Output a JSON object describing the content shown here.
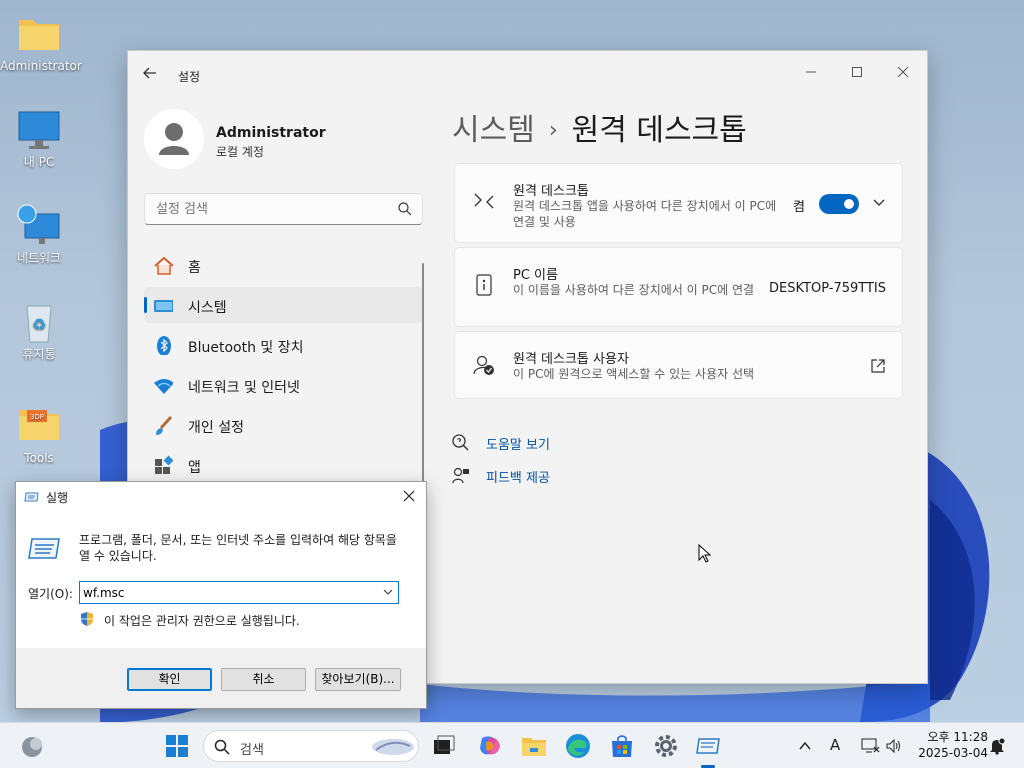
{
  "desktop": {
    "icons": [
      {
        "label": "Administrator"
      },
      {
        "label": "내 PC"
      },
      {
        "label": "네트워크"
      },
      {
        "label": "휴지통"
      },
      {
        "label": "Tools"
      }
    ]
  },
  "settings": {
    "title": "설정",
    "profile": {
      "name": "Administrator",
      "account": "로컬 계정"
    },
    "search_placeholder": "설정 검색",
    "nav": [
      {
        "label": "홈",
        "icon": "home-icon"
      },
      {
        "label": "시스템",
        "icon": "system-icon",
        "active": true
      },
      {
        "label": "Bluetooth 및 장치",
        "icon": "bluetooth-icon"
      },
      {
        "label": "네트워크 및 인터넷",
        "icon": "wifi-icon"
      },
      {
        "label": "개인 설정",
        "icon": "brush-icon"
      },
      {
        "label": "앱",
        "icon": "apps-icon"
      }
    ],
    "breadcrumb": {
      "parent": "시스템",
      "separator": "›",
      "current": "원격 데스크톱"
    },
    "cards": {
      "remote_desktop": {
        "title": "원격 데스크톱",
        "desc": "원격 데스크톱 앱을 사용하여 다른 장치에서 이 PC에 연결 및 사용",
        "toggle_label": "켬",
        "toggle_on": true
      },
      "pc_name": {
        "title": "PC 이름",
        "desc": "이 이름을 사용하여 다른 장치에서 이 PC에 연결",
        "value": "DESKTOP-759TTIS"
      },
      "users": {
        "title": "원격 데스크톱 사용자",
        "desc": "이 PC에 원격으로 액세스할 수 있는 사용자 선택"
      }
    },
    "links": {
      "help": "도움말 보기",
      "feedback": "피드백 제공"
    }
  },
  "run_dialog": {
    "title": "실행",
    "description": "프로그램, 폴더, 문서, 또는 인터넷 주소를 입력하여 해당 항목을 열 수 있습니다.",
    "open_label": "열기(O):",
    "open_value": "wf.msc",
    "admin_note": "이 작업은 관리자 권한으로 실행됩니다.",
    "buttons": {
      "ok": "확인",
      "cancel": "취소",
      "browse": "찾아보기(B)..."
    }
  },
  "taskbar": {
    "search_placeholder": "검색",
    "ime": "A",
    "clock_time": "오후 11:28",
    "clock_date": "2025-03-04"
  },
  "colors": {
    "accent": "#0067c0",
    "link": "#0054a6"
  }
}
